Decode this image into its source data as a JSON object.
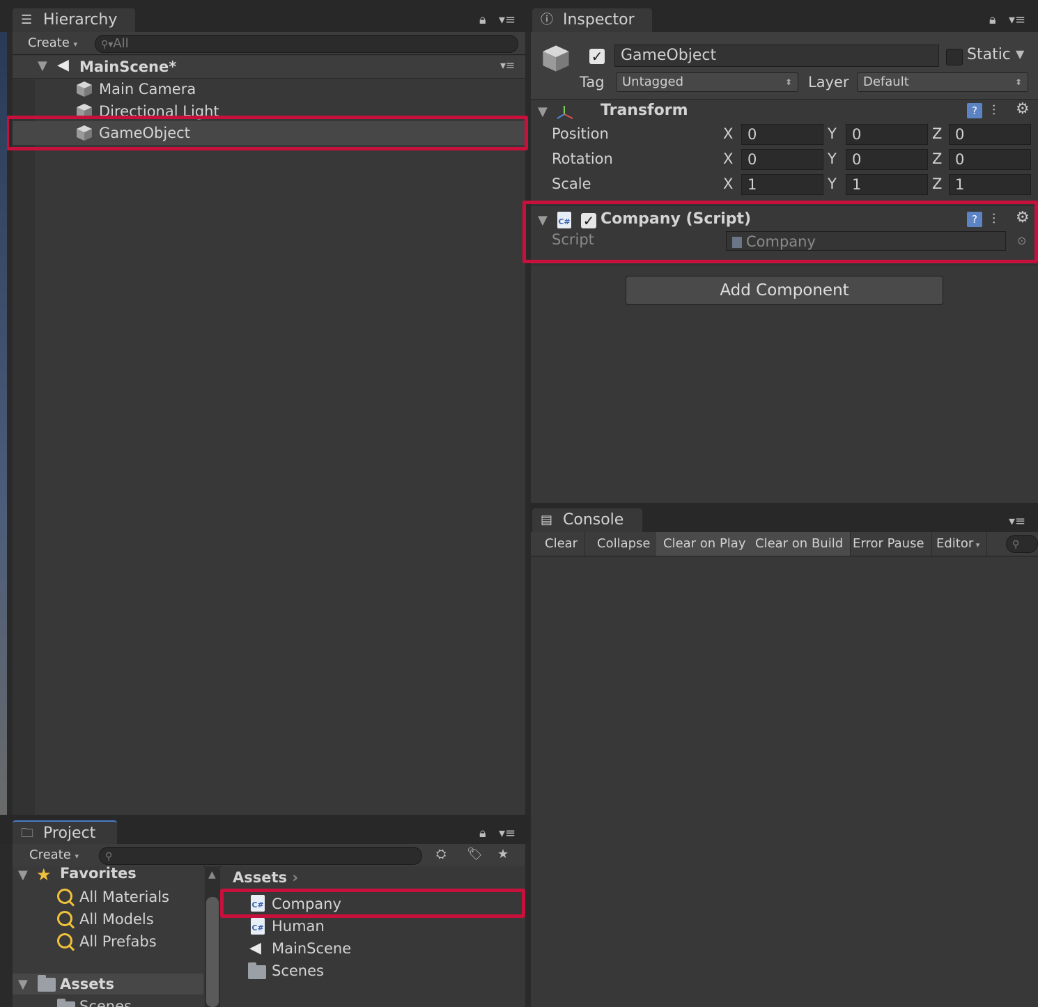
{
  "hierarchy": {
    "tab_label": "Hierarchy",
    "create_label": "Create",
    "search_placeholder": "All",
    "scene_name": "MainScene*",
    "items": [
      {
        "label": "Main Camera"
      },
      {
        "label": "Directional Light"
      },
      {
        "label": "GameObject"
      }
    ]
  },
  "inspector": {
    "tab_label": "Inspector",
    "object_name": "GameObject",
    "active_checked": true,
    "static_label": "Static",
    "static_checked": false,
    "tag_label": "Tag",
    "tag_value": "Untagged",
    "layer_label": "Layer",
    "layer_value": "Default",
    "transform": {
      "title": "Transform",
      "rows": [
        {
          "label": "Position",
          "x": "0",
          "y": "0",
          "z": "0"
        },
        {
          "label": "Rotation",
          "x": "0",
          "y": "0",
          "z": "0"
        },
        {
          "label": "Scale",
          "x": "1",
          "y": "1",
          "z": "1"
        }
      ],
      "axis_x": "X",
      "axis_y": "Y",
      "axis_z": "Z"
    },
    "script_component": {
      "title": "Company (Script)",
      "enabled": true,
      "field_label": "Script",
      "field_value": "Company",
      "cs_badge": "C#"
    },
    "add_component_label": "Add Component"
  },
  "console": {
    "tab_label": "Console",
    "buttons": [
      {
        "label": "Clear",
        "active": false
      },
      {
        "label": "Collapse",
        "active": false
      },
      {
        "label": "Clear on Play",
        "active": true
      },
      {
        "label": "Clear on Build",
        "active": true
      },
      {
        "label": "Error Pause",
        "active": false
      },
      {
        "label": "Editor",
        "active": false
      }
    ]
  },
  "project": {
    "tab_label": "Project",
    "create_label": "Create",
    "favorites_label": "Favorites",
    "favorites": [
      {
        "label": "All Materials"
      },
      {
        "label": "All Models"
      },
      {
        "label": "All Prefabs"
      }
    ],
    "assets_tree_label": "Assets",
    "assets_tree_child": "Scenes",
    "breadcrumb": "Assets",
    "assets": [
      {
        "label": "Company",
        "kind": "script"
      },
      {
        "label": "Human",
        "kind": "script"
      },
      {
        "label": "MainScene",
        "kind": "scene"
      },
      {
        "label": "Scenes",
        "kind": "folder"
      }
    ]
  },
  "colors": {
    "highlight": "#c8103c",
    "panel_bg": "#383838",
    "selection_bg": "#474747"
  }
}
